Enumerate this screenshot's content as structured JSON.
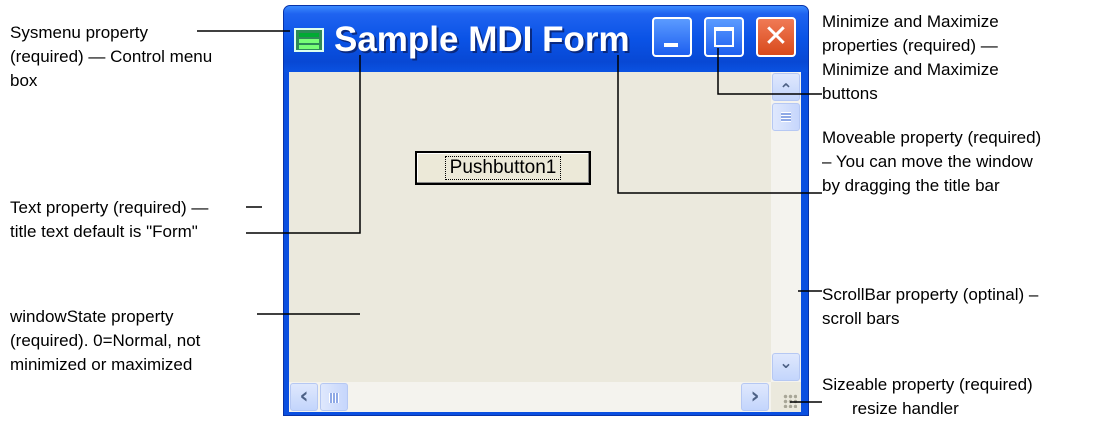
{
  "window": {
    "title": "Sample MDI Form",
    "pushbutton_label": "Pushbutton1",
    "title_bar_color": "#0a53e6",
    "client_color": "#ebe9dd"
  },
  "icons": {
    "sysmenu": "control-menu-icon",
    "minimize": "minimize-icon",
    "maximize": "maximize-icon",
    "close": "close-icon",
    "scroll_up": "chevron-up-icon",
    "scroll_down": "chevron-down-icon",
    "scroll_left": "chevron-left-icon",
    "scroll_right": "chevron-right-icon",
    "size_grip": "resize-grip-icon"
  },
  "glyphs": {
    "close": "✕",
    "up": "⌃",
    "down": "⌄",
    "left": "‹",
    "right": "›"
  },
  "callouts": {
    "sysmenu": [
      "Sysmenu property",
      "(required) — Control menu",
      "box"
    ],
    "text": [
      "Text property (required) —",
      "title text default is \"Form\""
    ],
    "windowstate": [
      "windowState property",
      "(required). 0=Normal, not",
      "minimized or maximized"
    ],
    "minmax": [
      "Minimize and Maximize",
      "properties (required) —",
      "Minimize and Maximize",
      "buttons"
    ],
    "moveable": [
      "Moveable property (required)",
      "– You can move the window",
      "by dragging the title bar"
    ],
    "scrollbar": [
      "ScrollBar property (optinal) –",
      "scroll bars"
    ],
    "sizeable": [
      "Sizeable property (required)",
      "resize handler"
    ]
  }
}
